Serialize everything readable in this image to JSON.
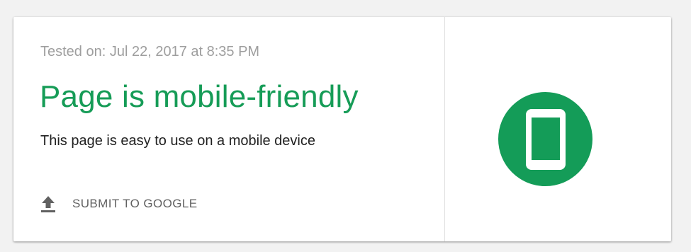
{
  "result": {
    "tested_on": "Tested on: Jul 22, 2017 at 8:35 PM",
    "headline": "Page is mobile-friendly",
    "description": "This page is easy to use on a mobile device",
    "submit_label": "SUBMIT TO GOOGLE",
    "submit_icon": "upload-icon",
    "status_icon": "mobile-phone-icon"
  },
  "colors": {
    "success_green": "#169c57",
    "muted_text": "#9e9e9e",
    "body_text": "#212121",
    "action_text": "#616161"
  }
}
